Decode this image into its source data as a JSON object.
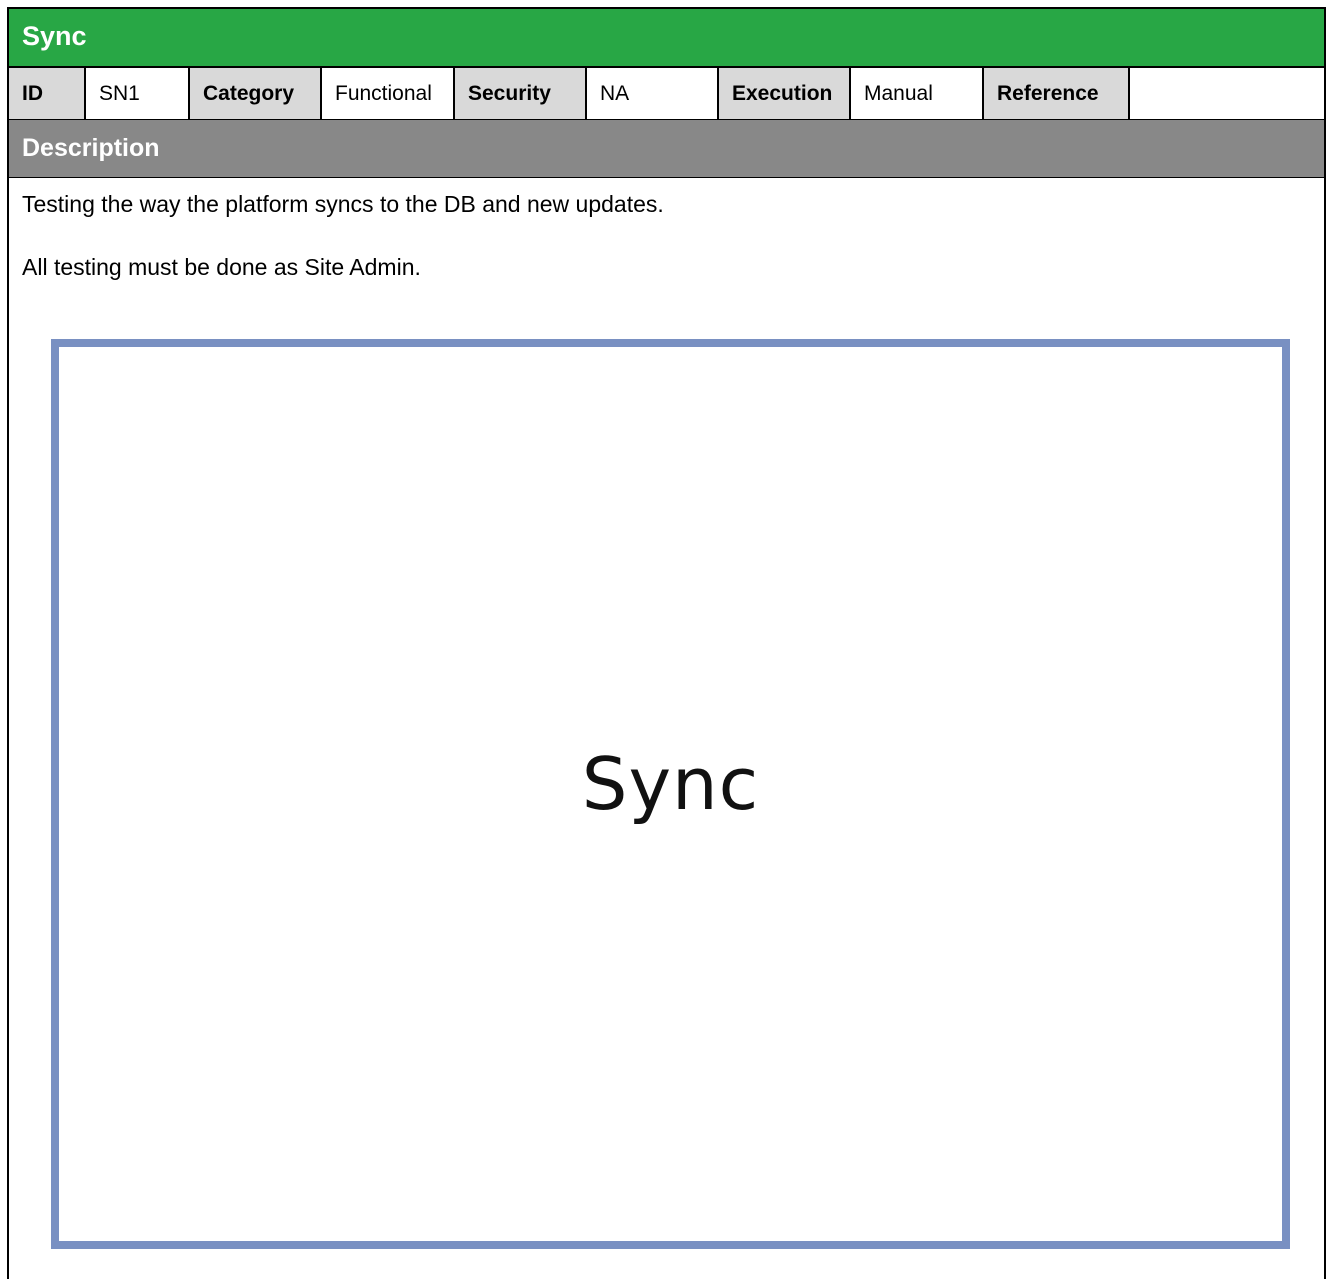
{
  "title": "Sync",
  "meta": {
    "id_label": "ID",
    "id_value": "SN1",
    "category_label": "Category",
    "category_value": "Functional",
    "security_label": "Security",
    "security_value": "NA",
    "execution_label": "Execution",
    "execution_value": "Manual",
    "reference_label": "Reference",
    "reference_value": ""
  },
  "description": {
    "header": "Description",
    "lines": [
      "Testing the way the platform syncs to the DB and new updates.",
      "All testing must be done as Site Admin."
    ]
  },
  "image": {
    "caption": "Sync",
    "border_color": "#7990c2"
  },
  "colors": {
    "title_bar": "#28a745",
    "label_cell": "#d9d9d9",
    "description_header": "#888888"
  }
}
